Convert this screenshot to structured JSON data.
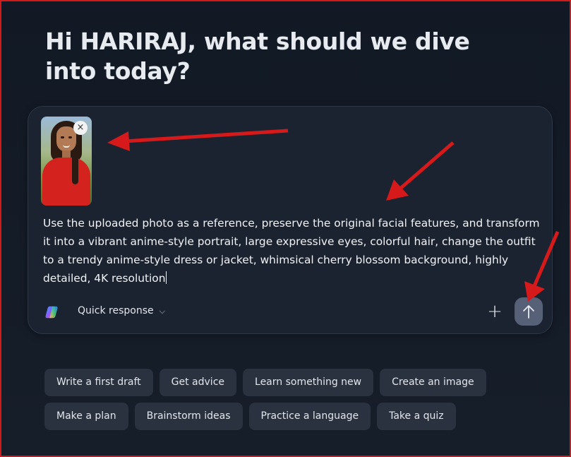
{
  "greeting": "Hi HARIRAJ, what should we dive into today?",
  "composer": {
    "attachment": {
      "alt": "Uploaded photo",
      "remove_icon": "×"
    },
    "prompt_text": "Use the uploaded photo as a reference, preserve the original facial features, and transform it into a vibrant anime-style portrait, large expressive eyes, colorful hair, change the outfit to a trendy anime-style dress or jacket, whimsical cherry blossom background, highly detailed, 4K resolution",
    "mode_label": "Quick response",
    "mode_chevron": "⌵",
    "plus_icon": "+",
    "send_icon": "arrow-up-icon"
  },
  "suggestions": {
    "row1": [
      "Write a first draft",
      "Get advice",
      "Learn something new",
      "Create an image"
    ],
    "row2": [
      "Make a plan",
      "Brainstorm ideas",
      "Practice a language",
      "Take a quiz"
    ]
  },
  "colors": {
    "background": "#141b26",
    "composer_bg": "#1b2330",
    "chip_bg": "#2a3240",
    "send_button_bg": "#566178",
    "annotation_arrow": "#d6191b",
    "frame_border": "#d11a1a"
  }
}
